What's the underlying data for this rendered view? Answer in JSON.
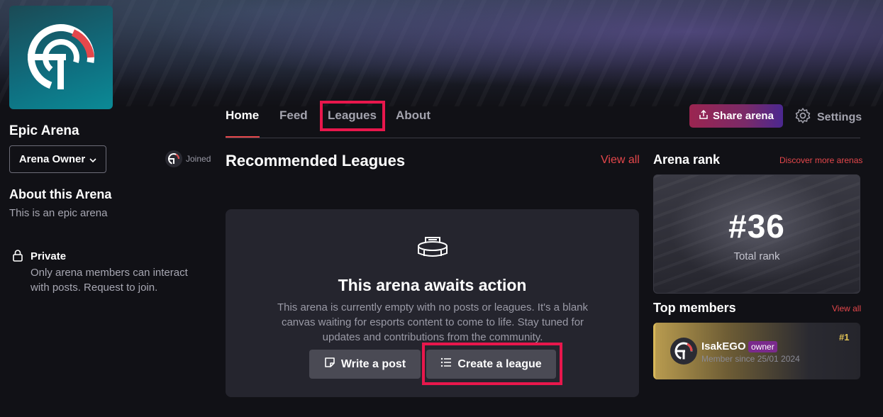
{
  "arena": {
    "name": "Epic Arena",
    "role_label": "Arena Owner",
    "joined_label": "Joined",
    "about_title": "About this Arena",
    "about_desc": "This is an epic arena",
    "private_title": "Private",
    "private_desc": "Only arena members can interact with posts. Request to join."
  },
  "tabs": [
    {
      "label": "Home"
    },
    {
      "label": "Feed"
    },
    {
      "label": "Leagues"
    },
    {
      "label": "About"
    }
  ],
  "actions": {
    "share_label": "Share arena",
    "settings_label": "Settings"
  },
  "recommended": {
    "title": "Recommended Leagues",
    "view_all": "View all"
  },
  "empty_state": {
    "title": "This arena awaits action",
    "desc": "This arena is currently empty with no posts or leagues. It's a blank canvas waiting for esports content to come to life. Stay tuned for updates and contributions from the community.",
    "write_post": "Write a post",
    "create_league": "Create a league"
  },
  "rank": {
    "title": "Arena rank",
    "discover": "Discover more arenas",
    "value": "#36",
    "label": "Total rank"
  },
  "top_members": {
    "title": "Top members",
    "view_all": "View all",
    "items": [
      {
        "name": "IsakEGO",
        "badge": "owner",
        "since": "Member since  25/01 2024",
        "rank": "#1"
      }
    ]
  },
  "colors": {
    "accent": "#e5474b",
    "highlight_box": "#e8174c",
    "background": "#111116",
    "card": "#25252e"
  }
}
